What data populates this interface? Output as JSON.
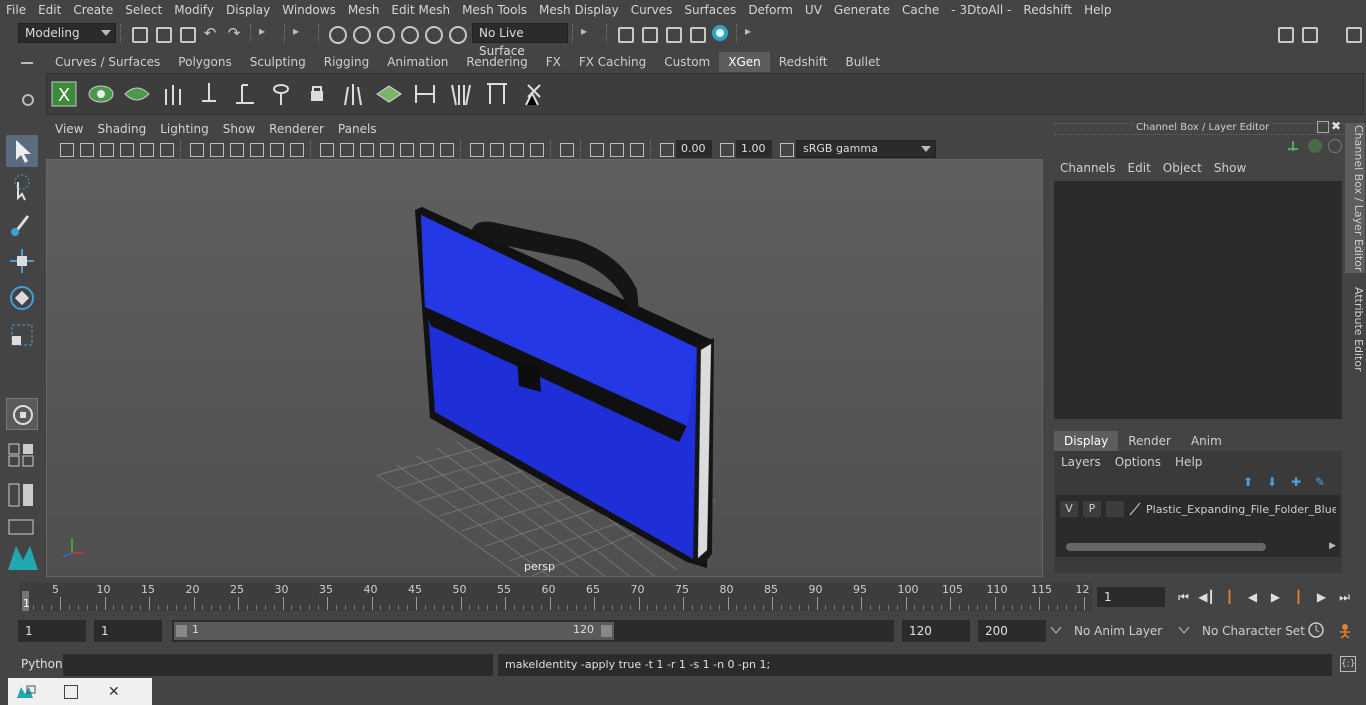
{
  "menubar": {
    "items": [
      "File",
      "Edit",
      "Create",
      "Select",
      "Modify",
      "Display",
      "Windows",
      "Mesh",
      "Edit Mesh",
      "Mesh Tools",
      "Mesh Display",
      "Curves",
      "Surfaces",
      "Deform",
      "UV",
      "Generate",
      "Cache",
      "- 3DtoAll -",
      "Redshift",
      "Help"
    ]
  },
  "statusline": {
    "mode": "Modeling",
    "live_surface": "No Live Surface"
  },
  "shelf": {
    "tabs": [
      "Curves / Surfaces",
      "Polygons",
      "Sculpting",
      "Rigging",
      "Animation",
      "Rendering",
      "FX",
      "FX Caching",
      "Custom",
      "XGen",
      "Redshift",
      "Bullet"
    ],
    "active_tab": "XGen"
  },
  "viewport": {
    "menu": [
      "View",
      "Shading",
      "Lighting",
      "Show",
      "Renderer",
      "Panels"
    ],
    "exposure": "0.00",
    "gamma": "1.00",
    "color_space": "sRGB gamma",
    "camera_label": "persp",
    "accent_color": "#1f2fd8"
  },
  "channelbox": {
    "title": "Channel Box / Layer Editor",
    "menu": [
      "Channels",
      "Edit",
      "Object",
      "Show"
    ],
    "layer_tabs": [
      "Display",
      "Render",
      "Anim"
    ],
    "active_layer_tab": "Display",
    "layer_menu": [
      "Layers",
      "Options",
      "Help"
    ],
    "layer": {
      "v": "V",
      "p": "P",
      "name": "Plastic_Expanding_File_Folder_Blue_C"
    }
  },
  "side_tabs": [
    "Channel Box / Layer Editor",
    "Attribute Editor"
  ],
  "timeline": {
    "ticks": [
      "5",
      "10",
      "15",
      "20",
      "25",
      "30",
      "35",
      "40",
      "45",
      "50",
      "55",
      "60",
      "65",
      "70",
      "75",
      "80",
      "85",
      "90",
      "95",
      "100",
      "105",
      "110",
      "115",
      "12"
    ],
    "start_marker": "1",
    "current_frame": "1"
  },
  "range": {
    "start": "1",
    "playback_start": "1",
    "slider_start": "1",
    "slider_end": "120",
    "playback_end": "120",
    "end": "200",
    "anim_layer": "No Anim Layer",
    "character_set": "No Character Set"
  },
  "cmdline": {
    "lang": "Python",
    "feedback": "makeIdentity -apply true -t 1 -r 1 -s 1 -n 0 -pn 1;"
  }
}
